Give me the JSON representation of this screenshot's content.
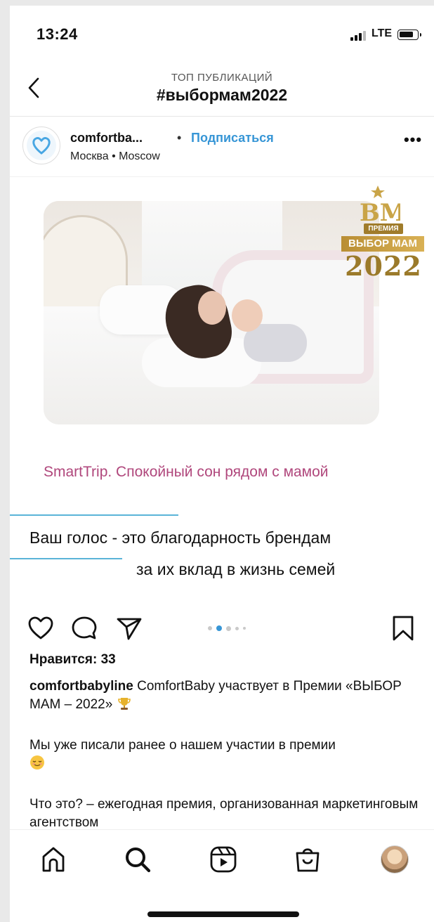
{
  "status_bar": {
    "time": "13:24",
    "network": "LTE"
  },
  "header": {
    "subtitle": "ТОП ПУБЛИКАЦИЙ",
    "title": "#выбормам2022"
  },
  "post": {
    "username_short": "comfortba...",
    "separator": "•",
    "follow_label": "Подписаться",
    "location": "Москва • Moscow",
    "more_label": "•••",
    "media": {
      "badge": {
        "award_label": "ПРЕМИЯ",
        "award_name": "ВЫБОР МАМ",
        "year": "2022",
        "monogram": "ВМ"
      },
      "caption": "SmartTrip. Спокойный сон рядом с мамой",
      "vote_line1": "Ваш голос - это  благодарность брендам",
      "vote_line2": "за их вклад в жизнь семей"
    },
    "carousel": {
      "count": 5,
      "active_index": 1
    },
    "likes_text": "Нравится: 33",
    "caption_user": "comfortbabyline",
    "caption_text1": " ComfortBaby участвует в Премии «ВЫБОР МАМ – 2022» ",
    "caption_text1_emoji": "trophy-emoji",
    "caption_text2": "Мы уже писали ранее о нашем участии в премии ",
    "caption_text2_emoji": "relieved-face-emoji",
    "caption_text3": "Что это? – ежегодная премия, организованная маркетинговым агентством"
  },
  "colors": {
    "accent": "#3796d6",
    "pink": "#b0477c",
    "gold": "#a07c2b",
    "line": "#5ab4d8"
  }
}
